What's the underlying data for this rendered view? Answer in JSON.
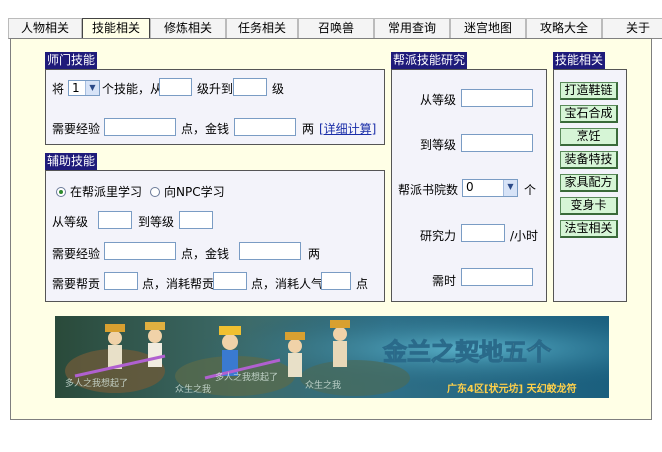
{
  "tabs": [
    "人物相关",
    "技能相关",
    "修炼相关",
    "任务相关",
    "召唤兽",
    "常用查询",
    "迷宫地图",
    "攻略大全",
    "关于"
  ],
  "active_tab": "技能相关",
  "master": {
    "title": "师门技能",
    "prefix": "将",
    "select_value": "1",
    "suffix": "个技能，从",
    "level_to": "级升到",
    "level_unit": "级",
    "exp_label": "需要经验",
    "money_label": "点，金钱",
    "money_unit": "两",
    "detail_link": "[详细计算]"
  },
  "aux": {
    "title": "辅助技能",
    "radio1": "在帮派里学习",
    "radio2": "向NPC学习",
    "from_label": "从等级",
    "to_label": "到等级",
    "exp_label": "需要经验",
    "money_label": "点，金钱",
    "money_unit": "两",
    "contrib_label": "需要帮贡",
    "consume_contrib": "点，消耗帮贡",
    "consume_pop": "点，消耗人气",
    "pop_unit": "点"
  },
  "research": {
    "title": "帮派技能研究",
    "from_label": "从等级",
    "to_label": "到等级",
    "school_label": "帮派书院数",
    "school_value": "0",
    "school_unit": "个",
    "power_label": "研究力",
    "power_unit": "/小时",
    "time_label": "需时"
  },
  "skills": {
    "title": "技能相关",
    "buttons": [
      "打造鞋链",
      "宝石合成",
      "烹饪",
      "装备特技",
      "家具配方",
      "变身卡",
      "法宝相关"
    ]
  },
  "banner": {
    "title": "金兰之契地五个",
    "subtitle": "广东4区[状元坊] 天幻蛟龙符",
    "watermarks": [
      "多人之我想起了",
      "众生之我",
      "多人之我想起了",
      "众生之我"
    ]
  },
  "colors": {
    "title_bg": "#1f1b7a",
    "panel_bg": "#f3f3fa",
    "outer_bg": "#ffffe6",
    "button_bg": "#d6f5d6"
  }
}
